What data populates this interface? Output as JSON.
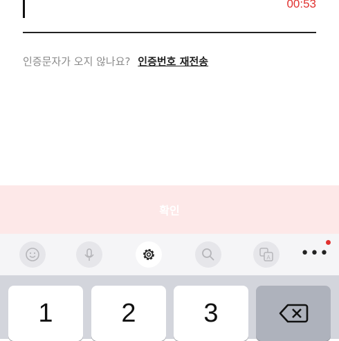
{
  "code_input": {
    "timer": "00:53"
  },
  "resend": {
    "question": "인증문자가 오지 않나요?",
    "link_label": "인증번호 재전송"
  },
  "confirm_label": "확인",
  "keyboard": {
    "toolbar_icons": [
      "emoji-icon",
      "microphone-icon",
      "gear-icon",
      "search-icon",
      "translate-icon",
      "more-icon"
    ],
    "keys": [
      "1",
      "2",
      "3"
    ],
    "delete_icon": "backspace-icon"
  },
  "colors": {
    "timer": "#e0312f",
    "confirm_bg": "#fde8e8",
    "keyboard_bg": "#d3d5dc"
  }
}
